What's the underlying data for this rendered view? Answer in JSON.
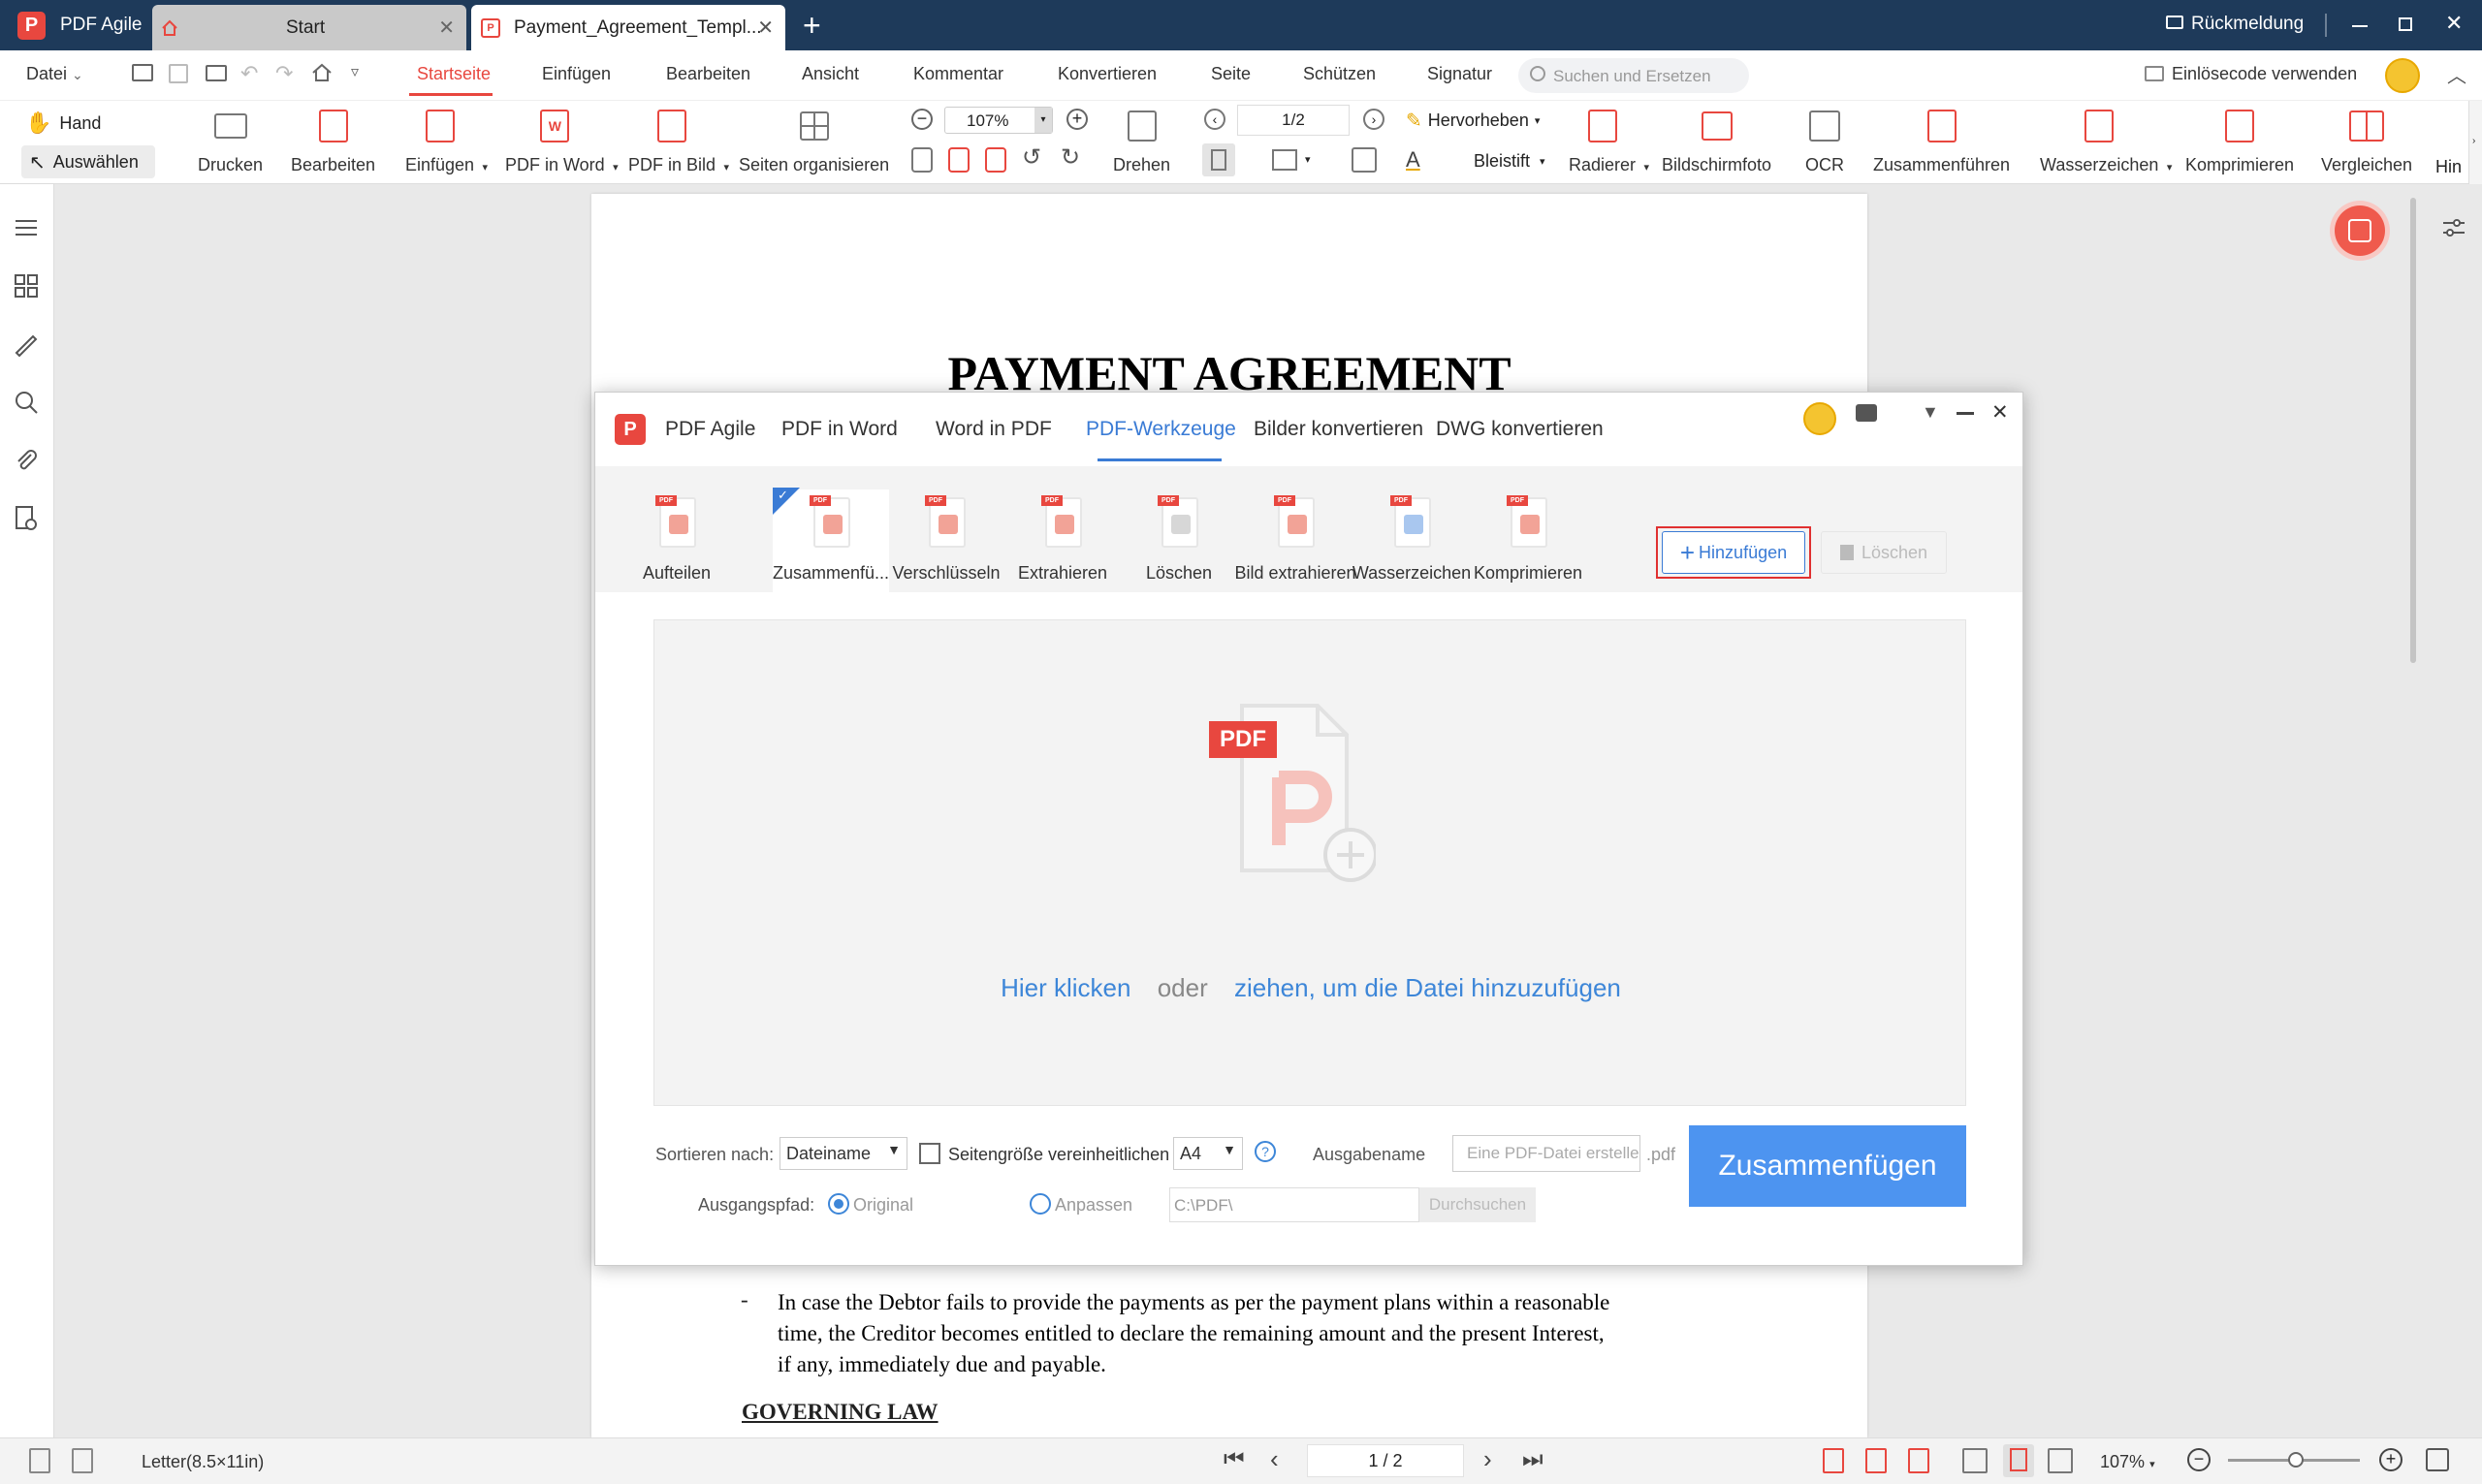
{
  "app": {
    "name": "PDF Agile"
  },
  "tabs": [
    {
      "label": "Start"
    },
    {
      "label": "Payment_Agreement_Templ..."
    }
  ],
  "window": {
    "feedback": "Rückmeldung"
  },
  "menu": {
    "file": "Datei",
    "items": [
      "Startseite",
      "Einfügen",
      "Bearbeiten",
      "Ansicht",
      "Kommentar",
      "Konvertieren",
      "Seite",
      "Schützen",
      "Signatur"
    ],
    "search_placeholder": "Suchen und Ersetzen",
    "redeem": "Einlösecode verwenden"
  },
  "ribbon": {
    "hand": "Hand",
    "select": "Auswählen",
    "print": "Drucken",
    "edit": "Bearbeiten",
    "insert": "Einfügen",
    "pdf_to_word": "PDF in Word",
    "pdf_to_image": "PDF in Bild",
    "organize": "Seiten organisieren",
    "zoom": "107%",
    "rotate": "Drehen",
    "page": "1/2",
    "highlight": "Hervorheben",
    "pencil": "Bleistift",
    "eraser": "Radierer",
    "screenshot": "Bildschirmfoto",
    "ocr": "OCR",
    "merge": "Zusammenführen",
    "watermark": "Wasserzeichen",
    "compress": "Komprimieren",
    "compare": "Vergleichen",
    "more": "Hin"
  },
  "document": {
    "title": "PAYMENT AGREEMENT",
    "bullet_lines": [
      "In case the Debtor fails to provide the payments as per the payment plans within a reasonable",
      "time, the Creditor becomes entitled to declare the remaining amount and the present Interest,",
      "if any, immediately due and payable."
    ],
    "heading": "GOVERNING LAW"
  },
  "dialog": {
    "brand": "PDF Agile",
    "tabs": [
      "PDF in Word",
      "Word in PDF",
      "PDF-Werkzeuge",
      "Bilder konvertieren",
      "DWG konvertieren"
    ],
    "tools": [
      "Aufteilen",
      "Zusammenfü...",
      "Verschlüsseln",
      "Extrahieren",
      "Löschen",
      "Bild extrahieren",
      "Wasserzeichen",
      "Komprimieren"
    ],
    "add_button": "Hinzufügen",
    "delete_button": "Löschen",
    "drop": {
      "badge": "PDF",
      "click": "Hier klicken",
      "or": "oder",
      "drag": "ziehen, um die Datei hinzuzufügen"
    },
    "sort_label": "Sortieren nach:",
    "sort_value": "Dateiname",
    "unify_label": "Seitengröße vereinheitlichen",
    "size_value": "A4",
    "output_name_label": "Ausgabename",
    "output_name_placeholder": "Eine PDF-Datei erstellen",
    "ext": ".pdf",
    "output_path_label": "Ausgangspfad:",
    "opt_original": "Original",
    "opt_custom": "Anpassen",
    "path_value": "C:\\PDF\\",
    "browse": "Durchsuchen",
    "merge_button": "Zusammenfügen"
  },
  "status": {
    "paper": "Letter(8.5×11in)",
    "page": "1 / 2",
    "zoom": "107%"
  },
  "colors": {
    "titlebar": "#1e3a5a",
    "accent_red": "#e8473f",
    "link_blue": "#3d86d8",
    "primary_button": "#4d94f0",
    "tab_active": "#3a7bd5"
  }
}
